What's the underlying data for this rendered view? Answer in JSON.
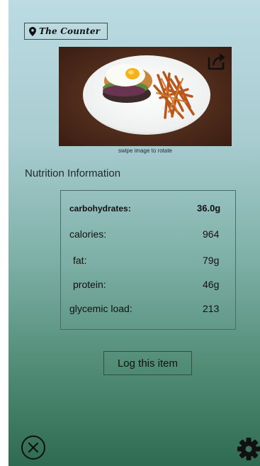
{
  "header": {
    "location_label": "The Counter"
  },
  "photo": {
    "caption": "swipe image to rotate",
    "share_icon": "share-icon"
  },
  "nutrition": {
    "heading": "Nutrition Information",
    "rows": [
      {
        "label": "carbohydrates:",
        "value": "36.0g"
      },
      {
        "label": "calories:",
        "value": "964"
      },
      {
        "label": "fat:",
        "value": "79g"
      },
      {
        "label": "protein:",
        "value": "46g"
      },
      {
        "label": "glycemic load:",
        "value": "213"
      }
    ]
  },
  "actions": {
    "log_label": "Log this item"
  },
  "footer": {
    "close_icon": "close-circle-icon",
    "settings_icon": "gear-icon"
  }
}
